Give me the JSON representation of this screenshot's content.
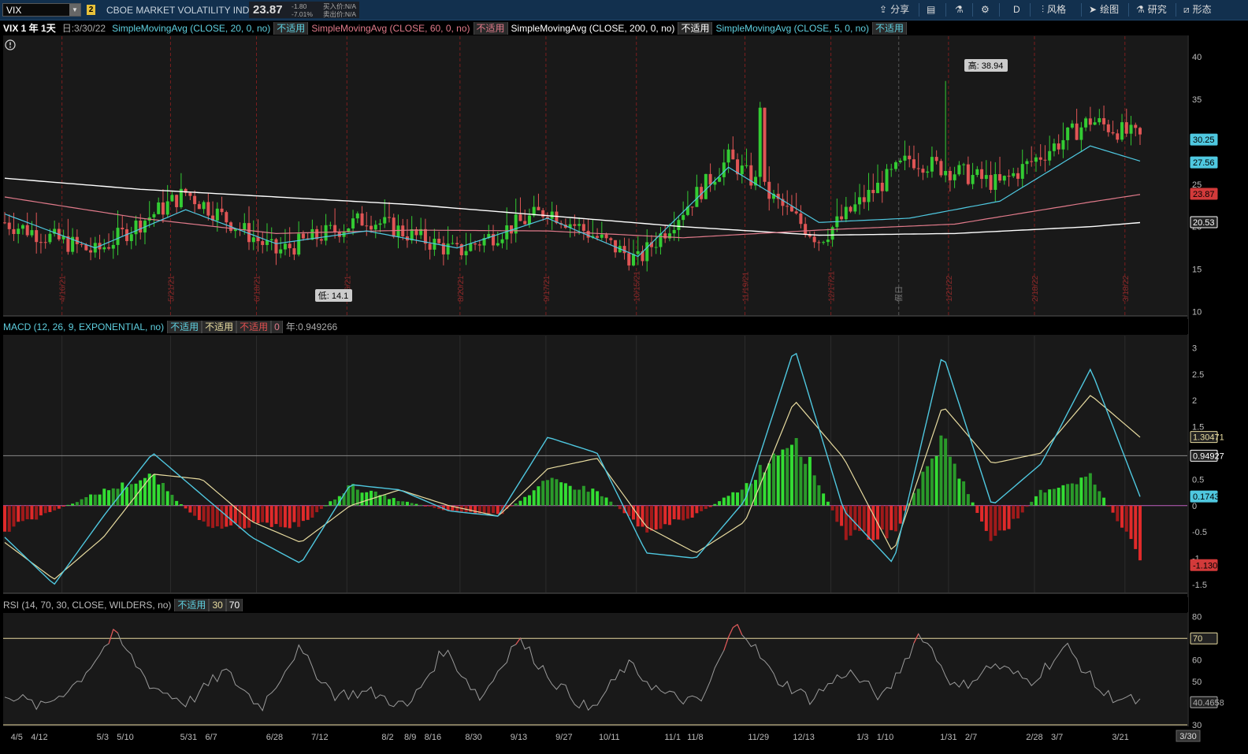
{
  "toolbar": {
    "symbol": "VIX",
    "link_group": "2",
    "description": "CBOE MARKET VOLATILITY INDEX",
    "last": "23.87",
    "change": "-1.80",
    "change_pct": "-7.01%",
    "bid": "买入价:N/A",
    "ask": "卖出价:N/A",
    "share_label": "分享",
    "period_label": "D",
    "style_label": "风格",
    "draw_label": "绘图",
    "study_label": "研究",
    "pattern_label": "形态"
  },
  "price_panel": {
    "title": "VIX 1 年 1天",
    "date": "日:3/30/22",
    "studies": [
      {
        "label": "SimpleMovingAvg (CLOSE, 20, 0, no)",
        "value": "不适用",
        "color": "#5fd0e0"
      },
      {
        "label": "SimpleMovingAvg (CLOSE, 60, 0, no)",
        "value": "不适用",
        "color": "#e07a8a"
      },
      {
        "label": "SimpleMovingAvg (CLOSE, 200, 0, no)",
        "value": "不适用",
        "color": "#ffffff"
      },
      {
        "label": "SimpleMovingAvg (CLOSE, 5, 0, no)",
        "value": "不适用",
        "color": "#5fd0e0"
      }
    ],
    "y_ticks": [
      "40",
      "35",
      "30",
      "25",
      "20",
      "15",
      "10"
    ],
    "high_label": "高: 38.94",
    "low_label": "低: 14.1",
    "date_marks": [
      "4/16/21",
      "5/21/21",
      "6/18/21",
      "7/16/21",
      "8/20/21",
      "9/17/21",
      "10/15/21",
      "11/19/21",
      "12/17/21",
      "假日",
      "1/21/22",
      "2/18/22",
      "3/18/22"
    ],
    "price_tags": [
      {
        "text": "30.25",
        "color": "#4fc8e0"
      },
      {
        "text": "27.56",
        "color": "#4fc8e0"
      },
      {
        "text": "23.87",
        "color": "#d23a3a"
      },
      {
        "text": "20.53",
        "color": "#ffffff"
      }
    ]
  },
  "macd_panel": {
    "label": "MACD (12, 26, 9, EXPONENTIAL, no)",
    "values": [
      "不适用",
      "不适用",
      "不适用"
    ],
    "zero": "0",
    "extra": "年:0.949266",
    "y_ticks": [
      "3",
      "2.5",
      "2",
      "1.5",
      "1",
      "0.5",
      "0",
      "-0.5",
      "-1",
      "-1.5"
    ],
    "tags": [
      {
        "text": "1.30471",
        "color": "#e8dca0"
      },
      {
        "text": "0.94927",
        "color": "#ffffff"
      },
      {
        "text": "0.17439",
        "color": "#4fc8e0"
      },
      {
        "text": "-1.1303",
        "color": "#d23a3a"
      }
    ]
  },
  "rsi_panel": {
    "label": "RSI (14, 70, 30, CLOSE, WILDERS, no)",
    "value": "不适用",
    "os": "30",
    "ob": "70",
    "y_ticks": [
      "80",
      "70",
      "60",
      "50",
      "40",
      "30"
    ],
    "tags": [
      {
        "text": "70",
        "color": "#e8dca0"
      },
      {
        "text": "40.4658",
        "color": "#aaaaaa"
      }
    ]
  },
  "x_axis": {
    "labels": [
      "4/5",
      "4/12",
      "5/3",
      "5/10",
      "5/31",
      "6/7",
      "6/28",
      "7/12",
      "8/2",
      "8/9",
      "8/16",
      "8/30",
      "9/13",
      "9/27",
      "10/11",
      "11/1",
      "11/8",
      "11/29",
      "12/13",
      "1/3",
      "1/10",
      "1/31",
      "2/7",
      "2/28",
      "3/7",
      "3/21"
    ],
    "current": "3/30"
  },
  "chart_data": [
    {
      "type": "candlestick",
      "title": "VIX 1 年 1天",
      "ylim": [
        10,
        42
      ],
      "series": [
        {
          "name": "SimpleMovingAvg (CLOSE, 200, 0, no)",
          "x": [
            0,
            30,
            60,
            90,
            120,
            150,
            180,
            210,
            240,
            252
          ],
          "values": [
            25.7,
            24.4,
            23.5,
            22.6,
            21.3,
            20.0,
            19.0,
            19.2,
            20.0,
            20.53
          ]
        },
        {
          "name": "SimpleMovingAvg (CLOSE, 60, 0, no)",
          "x": [
            0,
            30,
            60,
            90,
            120,
            150,
            180,
            210,
            240,
            252
          ],
          "values": [
            23.5,
            21.0,
            19.2,
            19.6,
            19.5,
            18.7,
            19.6,
            20.3,
            22.9,
            23.87
          ]
        },
        {
          "name": "SimpleMovingAvg (CLOSE, 20, 0, no)",
          "x": [
            0,
            20,
            40,
            60,
            80,
            100,
            120,
            140,
            160,
            180,
            200,
            220,
            240,
            252
          ],
          "values": [
            21.5,
            17.5,
            22.0,
            18.0,
            19.5,
            17.5,
            21.0,
            16.5,
            27.0,
            20.5,
            21.0,
            23.0,
            29.5,
            27.56
          ]
        },
        {
          "name": "SimpleMovingAvg (CLOSE, 5, 0, no)",
          "x": [
            0,
            20,
            40,
            60,
            80,
            100,
            120,
            140,
            160,
            180,
            200,
            220,
            240,
            252
          ],
          "values": [
            20.5,
            17.0,
            24.0,
            17.0,
            21.0,
            17.0,
            22.0,
            16.0,
            28.0,
            18.5,
            28.0,
            25.0,
            32.5,
            30.25
          ]
        }
      ],
      "high": 38.94,
      "low": 14.1
    },
    {
      "type": "line",
      "title": "MACD (12, 26, 9, EXPONENTIAL, no)",
      "ylim": [
        -1.6,
        3.1
      ],
      "series": [
        {
          "name": "Value",
          "values": [
            -0.6,
            -1.5,
            -0.2,
            1.0,
            0.2,
            -0.6,
            -1.1,
            0.4,
            0.3,
            -0.1,
            -0.2,
            1.3,
            1.0,
            -0.9,
            -1.0,
            0.1,
            3.0,
            -0.1,
            -1.1,
            2.9,
            0.0,
            0.8,
            2.6,
            0.17
          ]
        },
        {
          "name": "Avg",
          "values": [
            -0.7,
            -1.4,
            -0.6,
            0.6,
            0.5,
            -0.3,
            -0.7,
            0.0,
            0.3,
            0.0,
            -0.2,
            0.7,
            0.9,
            -0.4,
            -0.9,
            -0.3,
            2.0,
            0.9,
            -0.9,
            1.9,
            0.8,
            1.0,
            2.1,
            1.3
          ]
        }
      ],
      "histogram": [
        -0.5,
        -0.1,
        0.3,
        0.6,
        -0.4,
        -0.4,
        -0.4,
        0.4,
        0.1,
        -0.1,
        -0.2,
        0.5,
        0.3,
        -0.5,
        -0.2,
        0.4,
        1.5,
        -0.6,
        -0.6,
        1.4,
        -0.8,
        0.3,
        0.6,
        -1.1
      ]
    },
    {
      "type": "line",
      "title": "RSI (14, 70, 30, CLOSE, WILDERS, no)",
      "ylim": [
        30,
        80
      ],
      "series": [
        {
          "name": "RSI",
          "values": [
            45,
            38,
            50,
            72,
            48,
            40,
            55,
            38,
            65,
            44,
            45,
            38,
            65,
            42,
            70,
            50,
            36,
            58,
            44,
            40,
            78,
            52,
            42,
            55,
            42,
            73,
            46,
            58,
            50,
            66,
            44,
            40.47
          ]
        }
      ]
    }
  ]
}
